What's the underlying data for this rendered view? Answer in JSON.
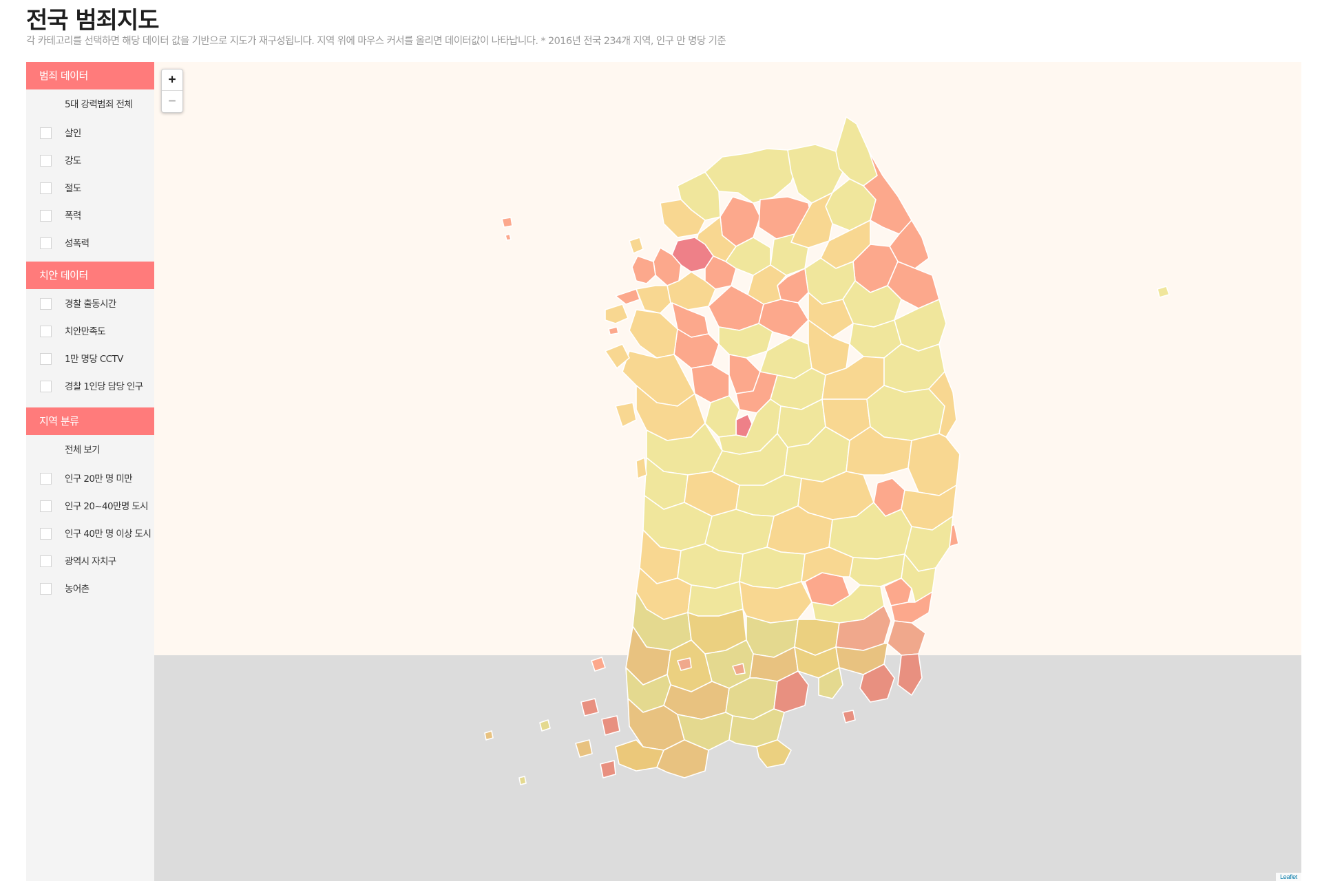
{
  "page": {
    "title": "전국 범죄지도",
    "subtitle": "각 카테고리를 선택하면 해당 데이터 값을 기반으로 지도가 재구성됩니다. 지역 위에 마우스 커서를 올리면 데이터값이 나타납니다. * 2016년 전국 234개 지역, 인구 만 명당 기준"
  },
  "sidebar": {
    "crime": {
      "header": "범죄 데이터",
      "all_label": "5대 강력범죄 전체",
      "items": [
        {
          "label": "살인"
        },
        {
          "label": "강도"
        },
        {
          "label": "절도"
        },
        {
          "label": "폭력"
        },
        {
          "label": "성폭력"
        }
      ]
    },
    "safety": {
      "header": "치안 데이터",
      "items": [
        {
          "label": "경찰 출동시간"
        },
        {
          "label": "치안만족도"
        },
        {
          "label": "1만 명당 CCTV"
        },
        {
          "label": "경찰 1인당 담당 인구"
        }
      ]
    },
    "region": {
      "header": "지역 분류",
      "all_label": "전체 보기",
      "items": [
        {
          "label": "인구 20만 명 미만"
        },
        {
          "label": "인구 20~40만명 도시"
        },
        {
          "label": "인구 40만 명 이상 도시"
        },
        {
          "label": "광역시 자치구"
        },
        {
          "label": "농어촌"
        }
      ]
    }
  },
  "map": {
    "zoom_in_label": "+",
    "zoom_out_label": "−",
    "attribution": "Leaflet",
    "colors": {
      "sea_upper": "#fff8f1",
      "sea_lower": "#dcdcdc",
      "low": "#f0e69c",
      "mid": "#f8d791",
      "high": "#fca88c",
      "highest": "#ee8088"
    }
  }
}
